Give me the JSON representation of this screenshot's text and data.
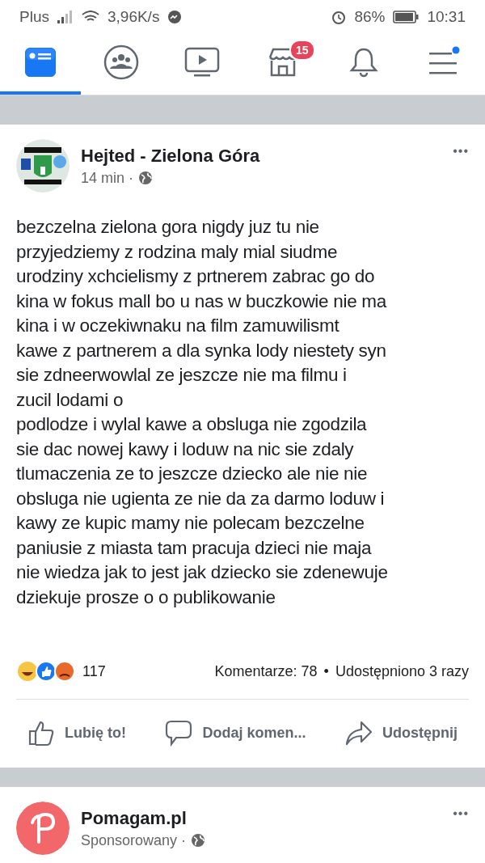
{
  "status_bar": {
    "carrier": "Plus",
    "speed": "3,96K/s",
    "battery": "86%",
    "time": "10:31"
  },
  "tabs": [
    {
      "kind": "feed",
      "selected": true
    },
    {
      "kind": "groups",
      "selected": false
    },
    {
      "kind": "watch",
      "selected": false
    },
    {
      "kind": "marketplace",
      "selected": false,
      "badge": "15"
    },
    {
      "kind": "notifications",
      "selected": false
    },
    {
      "kind": "menu",
      "selected": false
    }
  ],
  "post": {
    "author": "Hejted - Zielona Góra",
    "time": "14 min",
    "more": "•••",
    "lines": [
      "bezczelna zielona gora nigdy juz tu nie",
      "przyjedziemy z rodzina maly mial siudme",
      "urodziny xchcielismy z prtnerem zabrac go do",
      "kina w fokus mall bo u nas w buczkowie nie ma",
      "kina i w oczekiwnaku na film zamuwilismt",
      "kawe z partnerem a dla synka lody niestety syn",
      "sie zdneerwowlal ze jeszcze nie ma filmu i",
      "zucil lodami o",
      "podlodze i wylal kawe a obsluga nie zgodzila",
      "sie dac nowej kawy i loduw na nic sie zdaly",
      "tlumaczenia ze to jeszcze dziecko ale nie nie",
      "obsluga nie ugienta ze nie da za darmo loduw i",
      "kawy ze kupic mamy nie polecam bezczelne",
      "paniusie z miasta tam pracuja dzieci nie maja",
      "nie wiedza jak to jest jak dziecko sie zdenewuje",
      "dziekuje prosze o o publikowanie"
    ],
    "meta_separator": "·",
    "stats_separator": "•",
    "reactions": "117",
    "comments": "Komentarze: 78",
    "shares": "Udostępniono 3 razy",
    "actions": [
      {
        "kind": "like",
        "label": "Lubię to!"
      },
      {
        "kind": "comment",
        "label": "Dodaj komen..."
      },
      {
        "kind": "share",
        "label": "Udostępnij"
      }
    ]
  },
  "next_post": {
    "author": "Pomagam.pl",
    "subtitle": "Sponsorowany",
    "meta_separator": "·",
    "more": "•••"
  }
}
